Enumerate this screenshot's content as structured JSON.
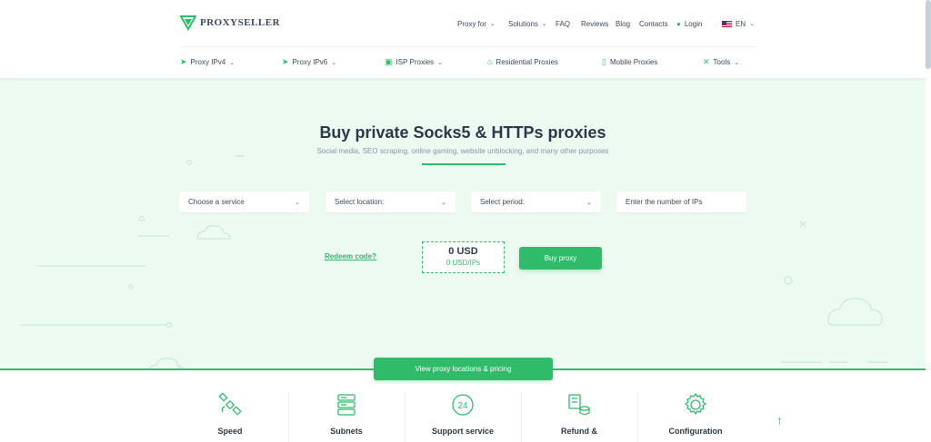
{
  "header": {
    "logo": "PROXYSELLER",
    "topnav": [
      {
        "label": "Proxy for",
        "dropdown": true
      },
      {
        "label": "Solutions",
        "dropdown": true
      },
      {
        "label": "FAQ",
        "dropdown": false
      },
      {
        "label": "Reviews",
        "dropdown": false
      },
      {
        "label": "Blog",
        "dropdown": false
      },
      {
        "label": "Contacts",
        "dropdown": false
      }
    ],
    "login": "Login",
    "language": "EN",
    "subnav": [
      {
        "label": "Proxy IPv4",
        "icon": "rocket-icon",
        "dropdown": true
      },
      {
        "label": "Proxy IPv6",
        "icon": "rocket-icon",
        "dropdown": true
      },
      {
        "label": "ISP Proxies",
        "icon": "cube-icon",
        "dropdown": true
      },
      {
        "label": "Residential Proxies",
        "icon": "home-icon",
        "dropdown": false
      },
      {
        "label": "Mobile Proxies",
        "icon": "phone-icon",
        "dropdown": false
      },
      {
        "label": "Tools",
        "icon": "tools-icon",
        "dropdown": true
      }
    ]
  },
  "hero": {
    "title": "Buy private Socks5 & HTTPs proxies",
    "subtitle": "Social media, SEO scraping, online gaming, website unblocking, and many other purposes",
    "fields": {
      "service": "Choose a service",
      "location": "Select location:",
      "period": "Select period:",
      "ips_placeholder": "Enter the number of IPs"
    },
    "redeem": "Redeem code?",
    "price": "0 USD",
    "price_per_ip": "0 USD/IPs",
    "buy_button": "Buy proxy",
    "view_button": "View proxy locations & pricing"
  },
  "features": [
    {
      "label": "Speed",
      "icon": "satellite-icon"
    },
    {
      "label": "Subnets",
      "icon": "server-icon"
    },
    {
      "label": "Support service",
      "icon": "support-24-icon"
    },
    {
      "label": "Refund &",
      "icon": "refund-icon"
    },
    {
      "label": "Configuration",
      "icon": "gear-icon"
    }
  ],
  "colors": {
    "accent": "#2fbb6a",
    "hero_bg": "#edfaf2",
    "text": "#2b3a4a"
  }
}
